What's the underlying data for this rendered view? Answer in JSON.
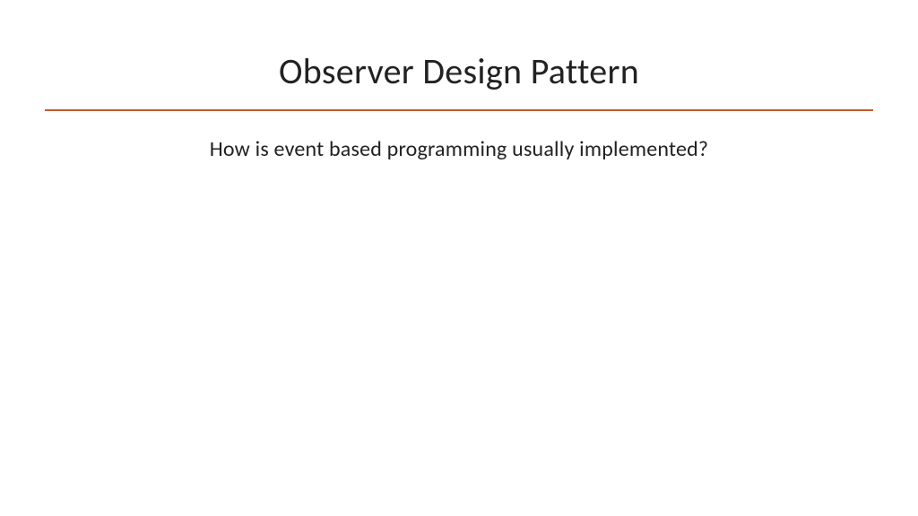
{
  "slide": {
    "title": "Observer Design Pattern",
    "subtitle": "How is event based programming usually implemented?"
  },
  "colors": {
    "accent": "#c55a2b",
    "text": "#222222"
  }
}
